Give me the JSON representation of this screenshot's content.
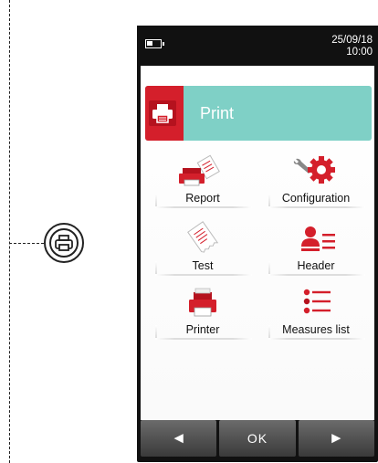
{
  "status": {
    "date": "25/09/18",
    "time": "10:00"
  },
  "title_bar": {
    "title": "Print"
  },
  "tiles": [
    {
      "label": "Report",
      "icon": "report-printer-icon"
    },
    {
      "label": "Configuration",
      "icon": "gear-wrench-icon"
    },
    {
      "label": "Test",
      "icon": "test-receipt-icon"
    },
    {
      "label": "Header",
      "icon": "header-person-icon"
    },
    {
      "label": "Printer",
      "icon": "printer-icon"
    },
    {
      "label": "Measures list",
      "icon": "measures-list-icon"
    }
  ],
  "nav": {
    "left": "◄",
    "ok": "OK",
    "right": "►"
  },
  "colors": {
    "accent_red": "#d41f2b",
    "title_teal": "#7fd0c6",
    "device_body": "#111111"
  }
}
